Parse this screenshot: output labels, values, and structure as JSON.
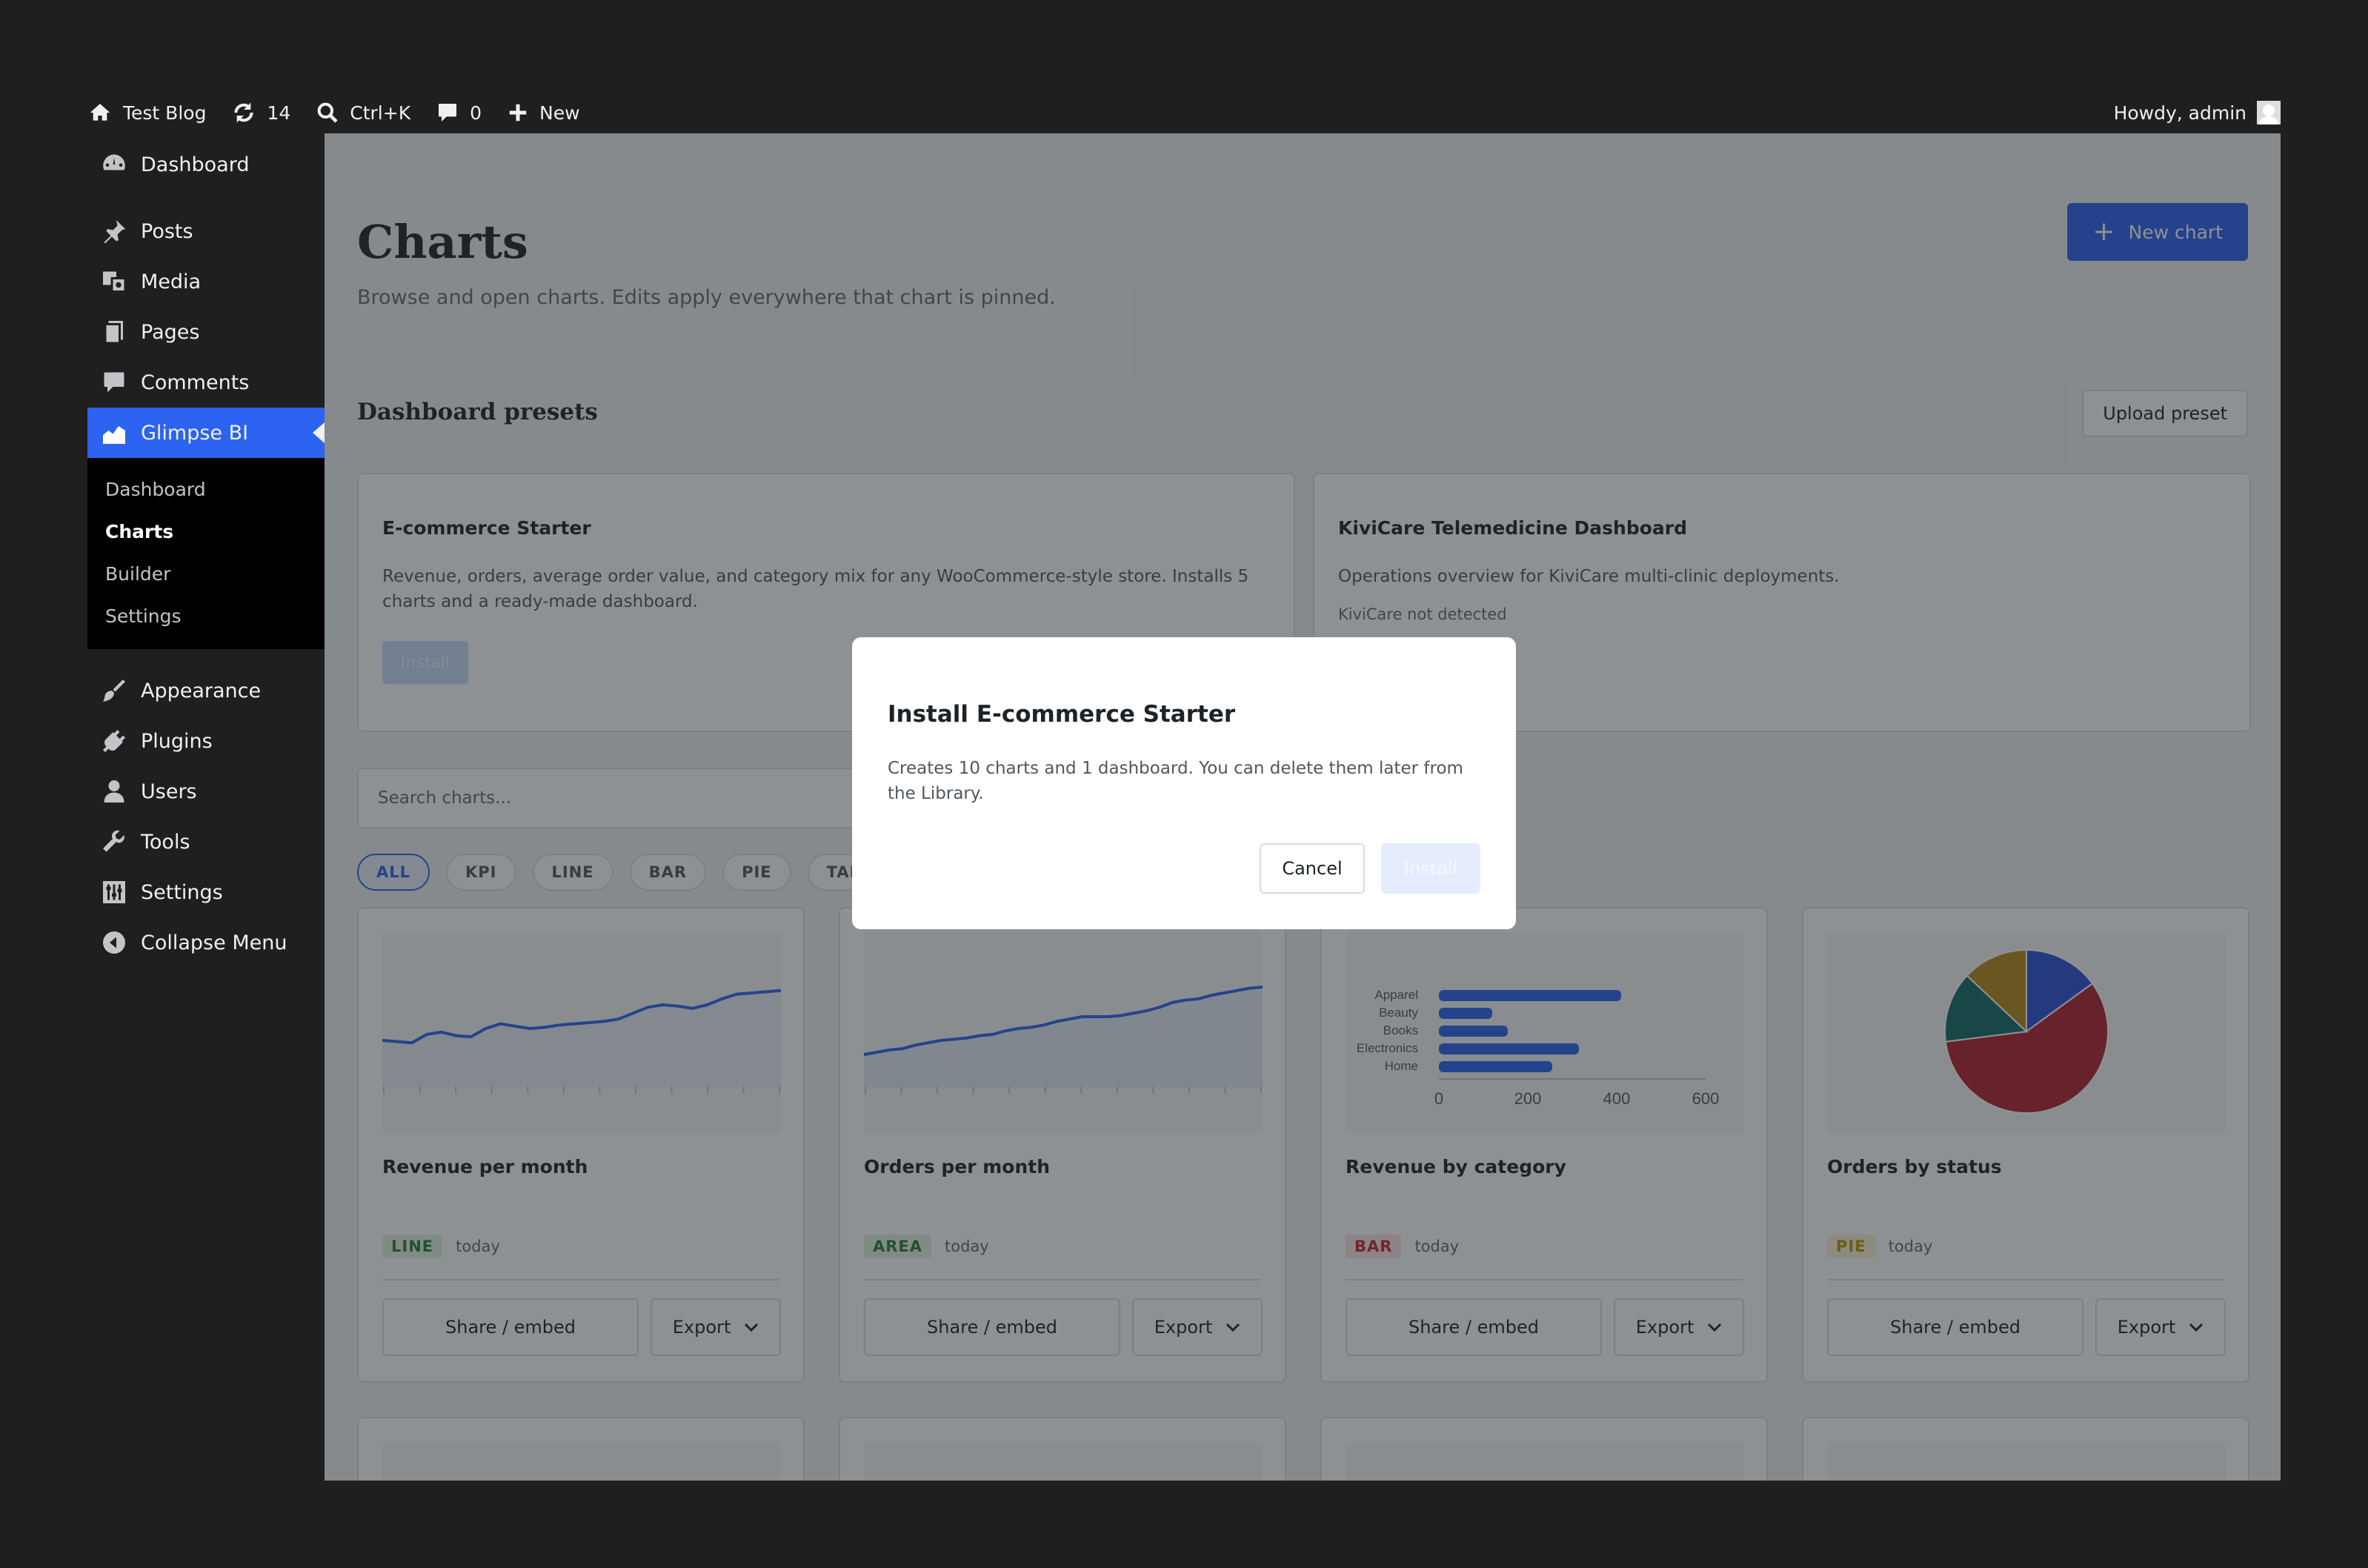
{
  "adminbar": {
    "site_name": "Test Blog",
    "updates_count": "14",
    "search_shortcut": "Ctrl+K",
    "comments_count": "0",
    "new_label": "New",
    "greeting": "Howdy, admin"
  },
  "sidebar": {
    "items": [
      {
        "label": "Dashboard",
        "icon": "dashboard-icon"
      },
      {
        "label": "Posts",
        "icon": "pin-icon"
      },
      {
        "label": "Media",
        "icon": "media-icon"
      },
      {
        "label": "Pages",
        "icon": "pages-icon"
      },
      {
        "label": "Comments",
        "icon": "comment-icon"
      },
      {
        "label": "Glimpse BI",
        "icon": "chart-area-icon"
      },
      {
        "label": "Appearance",
        "icon": "brush-icon"
      },
      {
        "label": "Plugins",
        "icon": "plugin-icon"
      },
      {
        "label": "Users",
        "icon": "user-icon"
      },
      {
        "label": "Tools",
        "icon": "wrench-icon"
      },
      {
        "label": "Settings",
        "icon": "sliders-icon"
      },
      {
        "label": "Collapse Menu",
        "icon": "collapse-icon"
      }
    ],
    "submenu": [
      "Dashboard",
      "Charts",
      "Builder",
      "Settings"
    ]
  },
  "page": {
    "title": "Charts",
    "subtitle": "Browse and open charts. Edits apply everywhere that chart is pinned.",
    "new_chart_label": "New chart",
    "presets_heading": "Dashboard presets",
    "upload_preset_label": "Upload preset",
    "presets": [
      {
        "name": "E-commerce Starter",
        "description": "Revenue, orders, average order value, and category mix for any WooCommerce-style store. Installs 5 charts and a ready-made dashboard.",
        "install_label": "Install"
      },
      {
        "name": "KiviCare Telemedicine Dashboard",
        "description": "Operations overview for KiviCare multi-clinic deployments.",
        "note": "KiviCare not detected"
      }
    ],
    "search_placeholder": "Search charts...",
    "filters": [
      "ALL",
      "KPI",
      "LINE",
      "BAR",
      "PIE",
      "TABLE"
    ],
    "cards": [
      {
        "title": "Revenue per month",
        "type": "LINE",
        "date": "today",
        "share_label": "Share / embed",
        "export_label": "Export"
      },
      {
        "title": "Orders per month",
        "type": "AREA",
        "date": "today",
        "share_label": "Share / embed",
        "export_label": "Export"
      },
      {
        "title": "Revenue by category",
        "type": "BAR",
        "date": "today",
        "share_label": "Share / embed",
        "export_label": "Export"
      },
      {
        "title": "Orders by status",
        "type": "PIE",
        "date": "today",
        "share_label": "Share / embed",
        "export_label": "Export"
      }
    ]
  },
  "modal": {
    "title": "Install E-commerce Starter",
    "body": "Creates 10 charts and 1 dashboard. You can delete them later from the Library.",
    "cancel_label": "Cancel",
    "install_label": "Install"
  },
  "colors": {
    "accent": "#2c63f0",
    "line_badge": "#2e7d32",
    "area_badge": "#2e7d32",
    "bar_badge": "#c62828",
    "pie_badge": "#b7950b"
  },
  "chart_data": [
    {
      "type": "line",
      "values": [
        40,
        39,
        38,
        45,
        47,
        44,
        43,
        50,
        54,
        52,
        50,
        51,
        53,
        54,
        55,
        56,
        58,
        63,
        68,
        70,
        69,
        67,
        70,
        75,
        79,
        80,
        81,
        82
      ]
    },
    {
      "type": "area",
      "values": [
        28,
        30,
        32,
        33,
        36,
        38,
        40,
        41,
        42,
        44,
        45,
        48,
        50,
        51,
        53,
        56,
        58,
        60,
        60,
        60,
        61,
        63,
        65,
        68,
        72,
        74,
        75,
        78,
        80,
        82,
        84,
        85
      ]
    },
    {
      "type": "bar",
      "categories": [
        "Apparel",
        "Beauty",
        "Books",
        "Electronics",
        "Home"
      ],
      "values": [
        410,
        120,
        155,
        315,
        255
      ],
      "xlim": [
        0,
        600
      ],
      "xticks": [
        0,
        200,
        400,
        600
      ]
    },
    {
      "type": "pie",
      "slices": [
        {
          "value": 15,
          "color": "#2c4fd6"
        },
        {
          "value": 58,
          "color": "#b3202e"
        },
        {
          "value": 14,
          "color": "#146b67"
        },
        {
          "value": 13,
          "color": "#b7891b"
        }
      ]
    }
  ]
}
